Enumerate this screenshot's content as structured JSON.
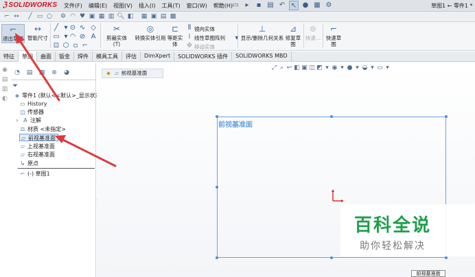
{
  "app": {
    "logo": "SOLIDWORKS",
    "doc_title": "草图1 ← 零件1 *"
  },
  "menu": [
    "文件(F)",
    "编辑(E)",
    "视图(V)",
    "插入(I)",
    "工具(T)",
    "窗口(W)",
    "帮助(H)"
  ],
  "ribbon": {
    "exit_sketch": "退出草图",
    "smart_dim": "智能尺寸",
    "trim_entities": "剪裁实体(T)",
    "convert_entities": "转换实体引用",
    "offset_entities_1": "等距实",
    "offset_entities_2": "体",
    "mirror_entities": "镜向实体",
    "linear_pattern": "线性草图阵列",
    "move_entities": "移动实体",
    "display_relations": "显示/删除几何关系",
    "repair_sketch_1": "修复草",
    "repair_sketch_2": "图",
    "quick_snaps": "快速...",
    "rapid_sketch_1": "快速草",
    "rapid_sketch_2": "图"
  },
  "tabs": [
    "特征",
    "草图",
    "曲面",
    "钣金",
    "焊件",
    "模具工具",
    "评估",
    "DimXpert",
    "SOLIDWORKS 插件",
    "SOLIDWORKS MBD"
  ],
  "active_tab": "草图",
  "breadcrumb": "前视基准面",
  "tree": {
    "part": "零件1 (默认<<默认>_显示状态",
    "history": "History",
    "sensors": "传感器",
    "annotations": "注解",
    "material": "材质 <未指定>",
    "front_plane": "前视基准面",
    "top_plane": "上视基准面",
    "right_plane": "右视基准面",
    "origin": "原点",
    "sketch": "(-) 草图1"
  },
  "plane_label": "前视基准面",
  "tooltip": "前视基准面",
  "watermark": {
    "title": "百科全说",
    "subtitle": "助你轻松解决"
  },
  "colors": {
    "plane": "#6aa3de",
    "arrow": "#e0383a",
    "watermark_green": "#1f9f4a",
    "logo_red": "#d3101c"
  }
}
